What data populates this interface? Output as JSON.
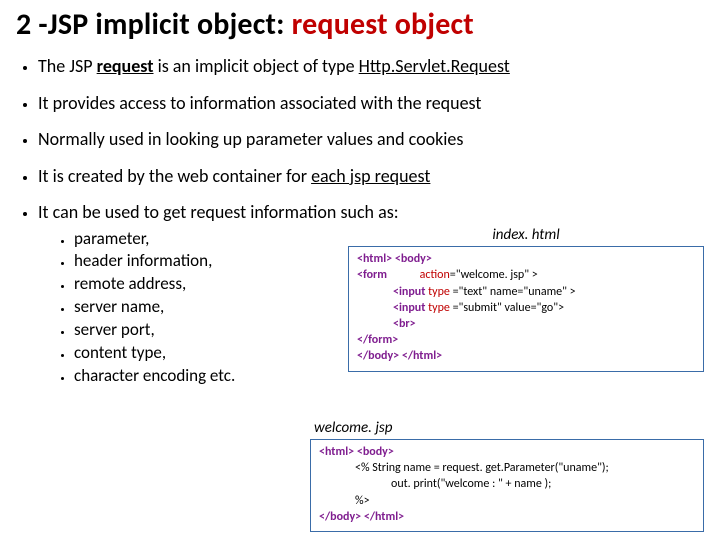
{
  "title": {
    "prefix": "2 -JSP implicit object: ",
    "accent": "request object"
  },
  "bullets": {
    "b1a": "The JSP ",
    "b1b": "request",
    "b1c": " is an implicit object of type ",
    "b1d": "Http.Servlet.Request",
    "b2": "It provides access to information associated with the request",
    "b3": "Normally used in looking up parameter values and cookies",
    "b4a": "It is created by the web container for ",
    "b4b": "each jsp request",
    "b5": "It can be used to get request information such as:"
  },
  "sub": {
    "s1": "parameter,",
    "s2": "header information,",
    "s3": "remote address,",
    "s4": "server name,",
    "s5": "server port,",
    "s6": "content type,",
    "s7": "character encoding etc."
  },
  "files": {
    "index_label": "index. html",
    "welcome_label": "welcome. jsp"
  },
  "code_index": {
    "l1a": "<html>  <body>",
    "l2_tag": "<form",
    "l2_attr": "action",
    "l2_rest": "=\"welcome. jsp\" >",
    "l3_tag": "<input ",
    "l3_attr": "type ",
    "l3_rest": "=\"text\" name=\"uname\" >",
    "l4_tag": "<input ",
    "l4_attr": "type ",
    "l4_rest": "=\"submit\"  value=\"go\">",
    "l5": "<br>",
    "l6": "</form>",
    "l7": "</body>  </html>"
  },
  "code_welcome": {
    "l1": "<html>  <body>",
    "l2": "<%  String name = request. get.Parameter(\"uname\");",
    "l3": "out. print(\"welcome : \" + name );",
    "l4": "%>",
    "l5": "</body>  </html>"
  }
}
